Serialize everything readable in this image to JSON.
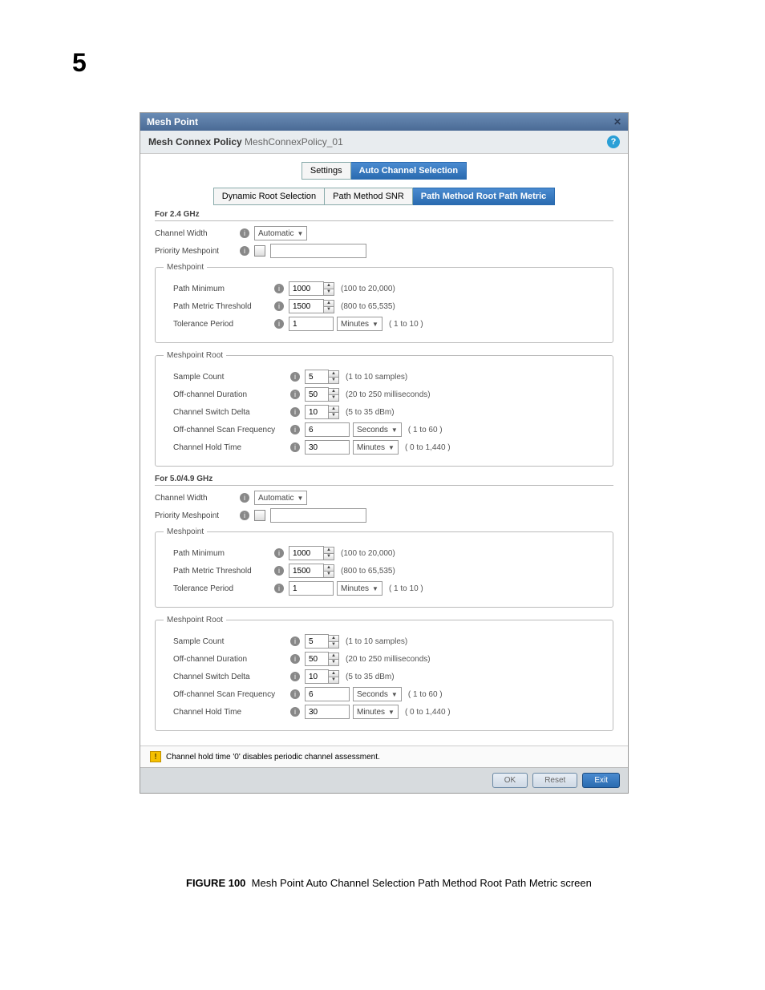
{
  "page_number": "5",
  "titlebar": {
    "title": "Mesh Point"
  },
  "subtitle": {
    "label": "Mesh Connex Policy",
    "value": "MeshConnexPolicy_01"
  },
  "tabs_main": {
    "settings": "Settings",
    "auto": "Auto Channel Selection"
  },
  "tabs_sub": {
    "drs": "Dynamic Root Selection",
    "snr": "Path Method SNR",
    "rpm": "Path Method Root Path Metric"
  },
  "band24": {
    "heading": "For 2.4 GHz",
    "channel_width_label": "Channel Width",
    "channel_width_value": "Automatic",
    "priority_meshpoint_label": "Priority Meshpoint",
    "priority_meshpoint_value": "",
    "meshpoint": {
      "legend": "Meshpoint",
      "path_min_label": "Path Minimum",
      "path_min_value": "1000",
      "path_min_hint": "(100 to 20,000)",
      "path_thresh_label": "Path Metric Threshold",
      "path_thresh_value": "1500",
      "path_thresh_hint": "(800 to 65,535)",
      "tol_label": "Tolerance Period",
      "tol_value": "1",
      "tol_unit": "Minutes",
      "tol_hint": "( 1 to 10 )"
    },
    "root": {
      "legend": "Meshpoint Root",
      "sample_label": "Sample Count",
      "sample_value": "5",
      "sample_hint": "(1 to 10 samples)",
      "off_dur_label": "Off-channel Duration",
      "off_dur_value": "50",
      "off_dur_hint": "(20 to 250 milliseconds)",
      "csd_label": "Channel Switch Delta",
      "csd_value": "10",
      "csd_hint": "(5 to 35 dBm)",
      "osf_label": "Off-channel Scan Frequency",
      "osf_value": "6",
      "osf_unit": "Seconds",
      "osf_hint": "( 1 to 60 )",
      "cht_label": "Channel Hold Time",
      "cht_value": "30",
      "cht_unit": "Minutes",
      "cht_hint": "( 0 to 1,440 )"
    }
  },
  "band5": {
    "heading": "For 5.0/4.9 GHz",
    "channel_width_label": "Channel Width",
    "channel_width_value": "Automatic",
    "priority_meshpoint_label": "Priority Meshpoint",
    "priority_meshpoint_value": "",
    "meshpoint": {
      "legend": "Meshpoint",
      "path_min_label": "Path Minimum",
      "path_min_value": "1000",
      "path_min_hint": "(100 to 20,000)",
      "path_thresh_label": "Path Metric Threshold",
      "path_thresh_value": "1500",
      "path_thresh_hint": "(800 to 65,535)",
      "tol_label": "Tolerance Period",
      "tol_value": "1",
      "tol_unit": "Minutes",
      "tol_hint": "( 1 to 10 )"
    },
    "root": {
      "legend": "Meshpoint Root",
      "sample_label": "Sample Count",
      "sample_value": "5",
      "sample_hint": "(1 to 10 samples)",
      "off_dur_label": "Off-channel Duration",
      "off_dur_value": "50",
      "off_dur_hint": "(20 to 250 milliseconds)",
      "csd_label": "Channel Switch Delta",
      "csd_value": "10",
      "csd_hint": "(5 to 35 dBm)",
      "osf_label": "Off-channel Scan Frequency",
      "osf_value": "6",
      "osf_unit": "Seconds",
      "osf_hint": "( 1 to 60 )",
      "cht_label": "Channel Hold Time",
      "cht_value": "30",
      "cht_unit": "Minutes",
      "cht_hint": "( 0 to 1,440 )"
    }
  },
  "warning": "Channel hold time '0' disables periodic channel assessment.",
  "footer": {
    "ok": "OK",
    "reset": "Reset",
    "exit": "Exit"
  },
  "caption": {
    "fig": "FIGURE 100",
    "text": "Mesh Point Auto Channel Selection Path Method Root Path Metric screen"
  }
}
